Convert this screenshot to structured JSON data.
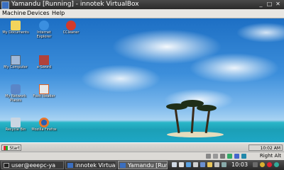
{
  "window": {
    "title": "Yamandu [Running] - innotek VirtualBox"
  },
  "menu": [
    "Machine",
    "Devices",
    "Help"
  ],
  "desktop_icons": [
    {
      "label": "My Documents",
      "icon": "folder-icon"
    },
    {
      "label": "Internet Explorer",
      "icon": "ie-icon"
    },
    {
      "label": "CCleaner",
      "icon": "ccleaner-icon"
    },
    {
      "label": "My Computer",
      "icon": "computer-icon"
    },
    {
      "label": "e-Sword",
      "icon": "esword-icon"
    },
    {
      "label": "My Network Places",
      "icon": "network-icon"
    },
    {
      "label": "Foxit Reader",
      "icon": "foxit-icon"
    },
    {
      "label": "Recycle Bin",
      "icon": "recycle-bin-icon"
    },
    {
      "label": "Mozilla Firefox",
      "icon": "firefox-icon"
    }
  ],
  "guest_taskbar": {
    "start_label": "Start",
    "clock": "10:02 AM"
  },
  "vbox_status": {
    "host_key": "Right Alt"
  },
  "host_panel": {
    "tasks": [
      "user@eeepc-ya",
      "innotek VirtualBo",
      "Yamandu [Run"
    ],
    "clock": "10:03"
  },
  "colors": {
    "sky": "#3d8fdb",
    "sea": "#1ea7c6",
    "panel": "#2e2e2e"
  }
}
